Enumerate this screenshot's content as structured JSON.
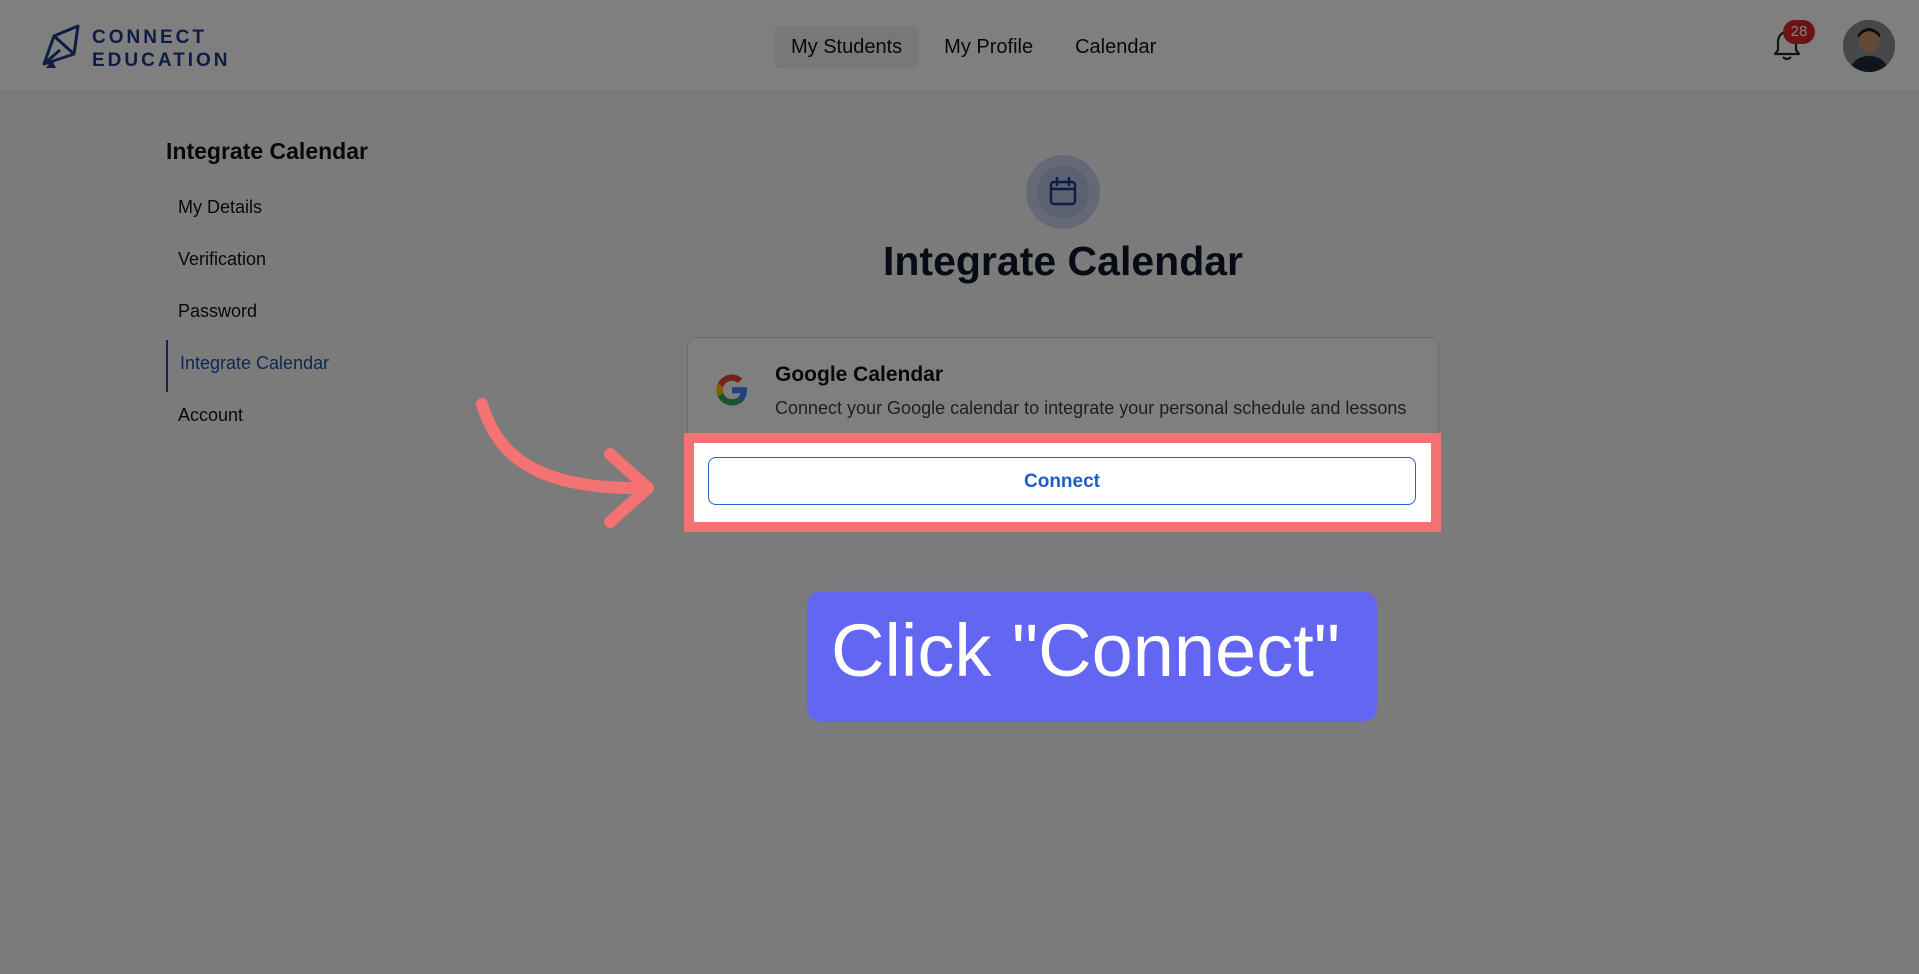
{
  "header": {
    "logo_line1": "CONNECT",
    "logo_line2": "EDUCATION",
    "nav": [
      "My Students",
      "My Profile",
      "Calendar"
    ],
    "notifications_count": "28"
  },
  "sidebar": {
    "title": "Integrate Calendar",
    "items": [
      "My Details",
      "Verification",
      "Password",
      "Integrate Calendar",
      "Account"
    ],
    "active_index": 3
  },
  "main": {
    "title": "Integrate Calendar",
    "card": {
      "title": "Google Calendar",
      "description": "Connect your Google calendar to integrate your personal schedule and lessons",
      "button_label": "Connect"
    }
  },
  "tutorial": {
    "tooltip_text": "Click \"Connect\"",
    "highlight_color": "#f47272",
    "tooltip_color": "#6366f1"
  },
  "colors": {
    "brand": "#1e3a8a",
    "accent": "#1f5fc4",
    "badge": "#dc2626"
  }
}
